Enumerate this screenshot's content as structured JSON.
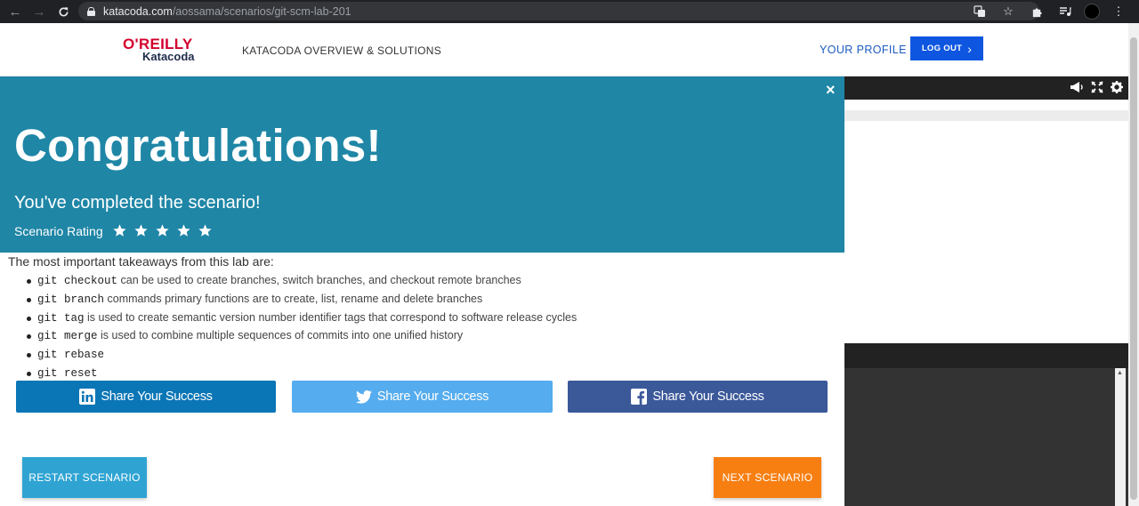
{
  "browser": {
    "url_host": "katacoda.com",
    "url_path": "/aossama/scenarios/git-scm-lab-201",
    "icons": [
      "back-icon",
      "forward-icon",
      "reload-icon",
      "lock-icon",
      "translate-icon",
      "star-icon",
      "extensions-icon",
      "media-icon",
      "profile-avatar",
      "menu-icon"
    ]
  },
  "header": {
    "logo_top": "O'REILLY",
    "logo_bottom": "Katacoda",
    "nav_overview": "KATACODA OVERVIEW & SOLUTIONS",
    "nav_profile": "YOUR PROFILE",
    "logout_label": "LOG OUT"
  },
  "terminal": {
    "icons": [
      "megaphone-icon",
      "fullscreen-icon",
      "settings-icon"
    ]
  },
  "modal": {
    "close_label": "×",
    "title": "Congratulations!",
    "subtitle": "You've completed the scenario!",
    "rating_label": "Scenario Rating",
    "rating_stars": 5,
    "takeaways_intro": "The most important takeaways from this lab are:",
    "takeaways": [
      {
        "code": "git checkout",
        "text": " can be used to create branches, switch branches, and checkout remote branches"
      },
      {
        "code": "git branch",
        "text": " commands primary functions are to create, list, rename and delete branches"
      },
      {
        "code": "git tag",
        "text": " is used to create semantic version number identifier tags that correspond to software release cycles"
      },
      {
        "code": "git merge",
        "text": " is used to combine multiple sequences of commits into one unified history"
      },
      {
        "code": "git rebase",
        "text": ""
      },
      {
        "code": "git reset",
        "text": ""
      }
    ],
    "share": {
      "linkedin": "Share Your Success",
      "twitter": "Share Your Success",
      "facebook": "Share Your Success"
    },
    "restart_label": "RESTART SCENARIO",
    "next_label": "NEXT SCENARIO"
  },
  "colors": {
    "modal_header": "#1f86a6",
    "linkedin": "#0b76b6",
    "twitter": "#55acee",
    "facebook": "#3b5899",
    "restart": "#2fa4d3",
    "next": "#f77f12",
    "logout": "#0e56e0"
  }
}
